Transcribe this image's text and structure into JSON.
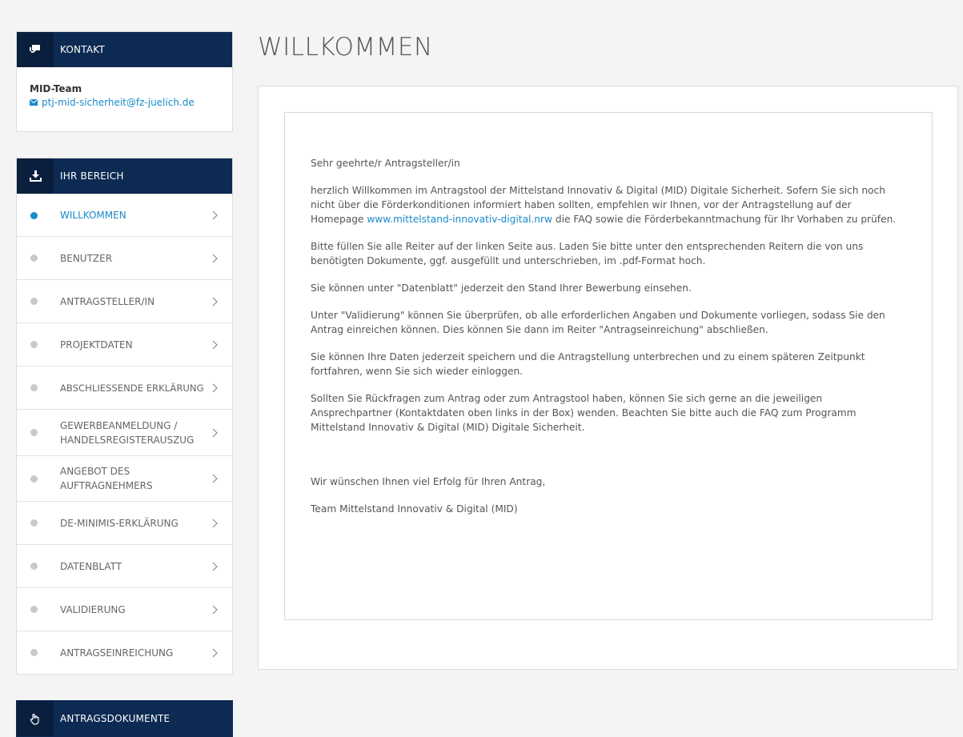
{
  "contact": {
    "header": "KONTAKT",
    "header_icon": "chat-bubbles-icon",
    "team": "MID-Team",
    "email": "ptj-mid-sicherheit@fz-juelich.de",
    "email_icon": "envelope-icon"
  },
  "area": {
    "header": "IHR BEREICH",
    "header_icon": "download-tray-icon",
    "items": [
      {
        "label": "WILLKOMMEN",
        "active": true
      },
      {
        "label": "BENUTZER",
        "active": false
      },
      {
        "label": "ANTRAGSTELLER/IN",
        "active": false
      },
      {
        "label": "PROJEKTDATEN",
        "active": false
      },
      {
        "label": "ABSCHLIESSENDE ERKLÄRUNG",
        "active": false
      },
      {
        "label_line1": "GEWERBEANMELDUNG /",
        "label_line2": "HANDELSREGISTERAUSZUG",
        "active": false
      },
      {
        "label_line1": "ANGEBOT DES",
        "label_line2": "AUFTRAGNEHMERS",
        "active": false
      },
      {
        "label": "DE-MINIMIS-ERKLÄRUNG",
        "active": false
      },
      {
        "label": "DATENBLATT",
        "active": false
      },
      {
        "label": "VALIDIERUNG",
        "active": false
      },
      {
        "label": "ANTRAGSEINREICHUNG",
        "active": false
      }
    ]
  },
  "docs": {
    "header": "ANTRAGSDOKUMENTE",
    "header_icon": "hand-pointer-icon"
  },
  "main": {
    "title": "WILLKOMMEN",
    "greeting": "Sehr geehrte/r Antragsteller/in",
    "p1_before": "herzlich Willkommen im Antragstool der Mittelstand Innovativ & Digital (MID) Digitale Sicherheit. Sofern Sie sich noch nicht über die Förderkonditionen informiert haben sollten, empfehlen wir Ihnen, vor der Antragstellung auf der Homepage ",
    "p1_link": "www.mittelstand-innovativ-digital.nrw",
    "p1_after": " die FAQ sowie die Förderbekanntmachung für Ihr Vorhaben zu prüfen.",
    "p2": "Bitte füllen Sie alle Reiter auf der linken Seite aus. Laden Sie bitte unter den entsprechenden Reitern die von uns benötigten Dokumente, ggf. ausgefüllt und unterschrieben, im .pdf-Format hoch.",
    "p3": "Sie können unter \"Datenblatt\" jederzeit den Stand Ihrer Bewerbung einsehen.",
    "p4": "Unter \"Validierung\" können Sie überprüfen, ob alle erforderlichen Angaben und Dokumente vorliegen, sodass Sie den Antrag einreichen können. Dies können Sie dann im Reiter \"Antragseinreichung\" abschließen.",
    "p5": "Sie können Ihre Daten jederzeit speichern und die Antragstellung unterbrechen und zu einem späteren Zeitpunkt fortfahren, wenn Sie sich wieder einloggen.",
    "p6": "Sollten Sie Rückfragen zum Antrag oder zum Antragstool haben, können Sie sich gerne an die jeweiligen Ansprechpartner (Kontaktdaten oben links in der Box) wenden. Beachten Sie bitte auch die FAQ zum Programm Mittelstand Innovativ & Digital (MID) Digitale Sicherheit.",
    "closing": "Wir wünschen Ihnen viel Erfolg für Ihren Antrag,",
    "signature": "Team Mittelstand Innovativ & Digital (MID)"
  },
  "colors": {
    "header_bg": "#0d2a52",
    "accent": "#1a8bc9",
    "inactive_dot": "#c9c9c9"
  }
}
